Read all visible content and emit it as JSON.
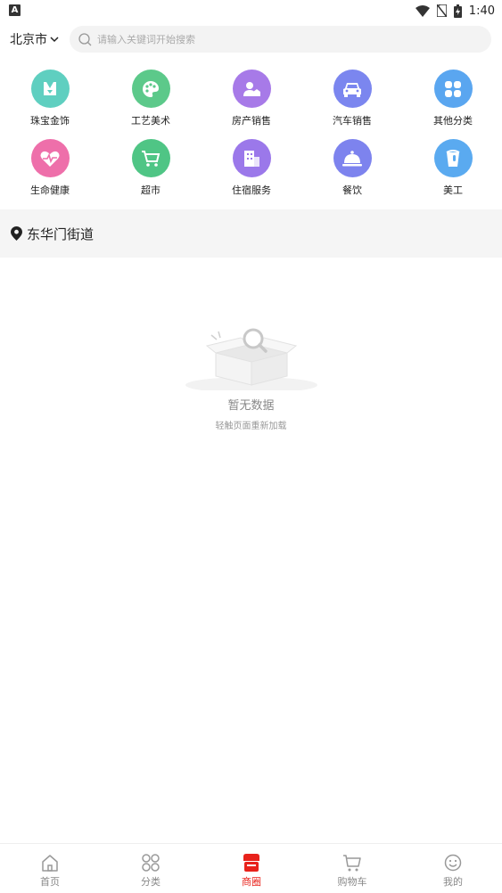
{
  "status_bar": {
    "time": "1:40",
    "indicator": "A"
  },
  "header": {
    "city": "北京市",
    "search_placeholder": "请输入关键词开始搜索"
  },
  "categories": [
    {
      "label": "珠宝金饰",
      "icon": "necklace-icon",
      "color": "#5fcfc0"
    },
    {
      "label": "工艺美术",
      "icon": "palette-icon",
      "color": "#5cc98a"
    },
    {
      "label": "房产销售",
      "icon": "house-person-icon",
      "color": "#a77ae8"
    },
    {
      "label": "汽车销售",
      "icon": "car-icon",
      "color": "#7b86ef"
    },
    {
      "label": "其他分类",
      "icon": "four-squares-icon",
      "color": "#5aa6f0"
    },
    {
      "label": "生命健康",
      "icon": "heart-pulse-icon",
      "color": "#ee6faa"
    },
    {
      "label": "超市",
      "icon": "cart-icon",
      "color": "#4fc585"
    },
    {
      "label": "住宿服务",
      "icon": "building-icon",
      "color": "#9b78ea"
    },
    {
      "label": "餐饮",
      "icon": "dish-cover-icon",
      "color": "#7d83ee"
    },
    {
      "label": "美工",
      "icon": "paint-bucket-icon",
      "color": "#5aaaf0"
    }
  ],
  "location": {
    "street": "东华门街道"
  },
  "empty_state": {
    "title": "暂无数据",
    "subtitle": "轻触页面重新加载"
  },
  "tabs": [
    {
      "label": "首页",
      "icon": "home-icon"
    },
    {
      "label": "分类",
      "icon": "grid-icon"
    },
    {
      "label": "商圈",
      "icon": "store-icon",
      "active": true
    },
    {
      "label": "购物车",
      "icon": "cart-icon"
    },
    {
      "label": "我的",
      "icon": "smiley-icon"
    }
  ],
  "colors": {
    "accent": "#e8221b",
    "search_bg": "#f3f3f3",
    "location_bg": "#f5f5f5"
  }
}
